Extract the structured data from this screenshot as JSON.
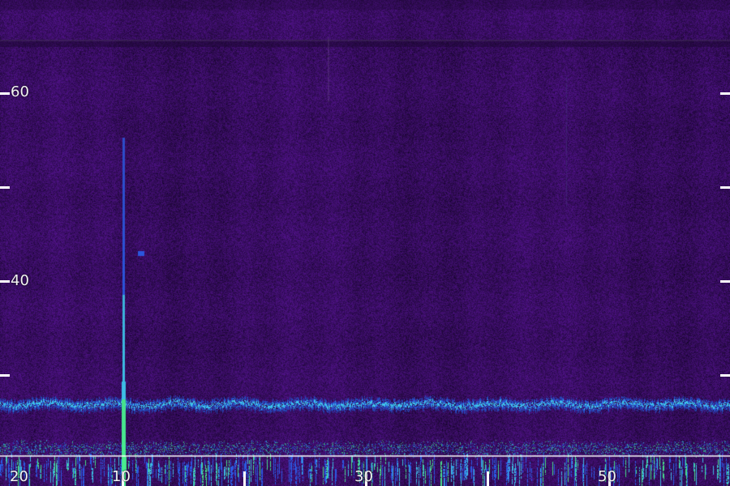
{
  "spectrogram": {
    "y_axis": {
      "labels": [
        "60",
        "40"
      ]
    },
    "x_axis": {
      "labels": [
        "20",
        "10",
        "30",
        "50"
      ]
    },
    "colors": {
      "background": "#230b3a",
      "noise_dark": "#1a0630",
      "noise_light": "#5e16a0",
      "band_blue": "#2d67ff",
      "band_cyan": "#42d8ff",
      "band_green": "#4dff98",
      "tick": "#ffffff"
    }
  }
}
